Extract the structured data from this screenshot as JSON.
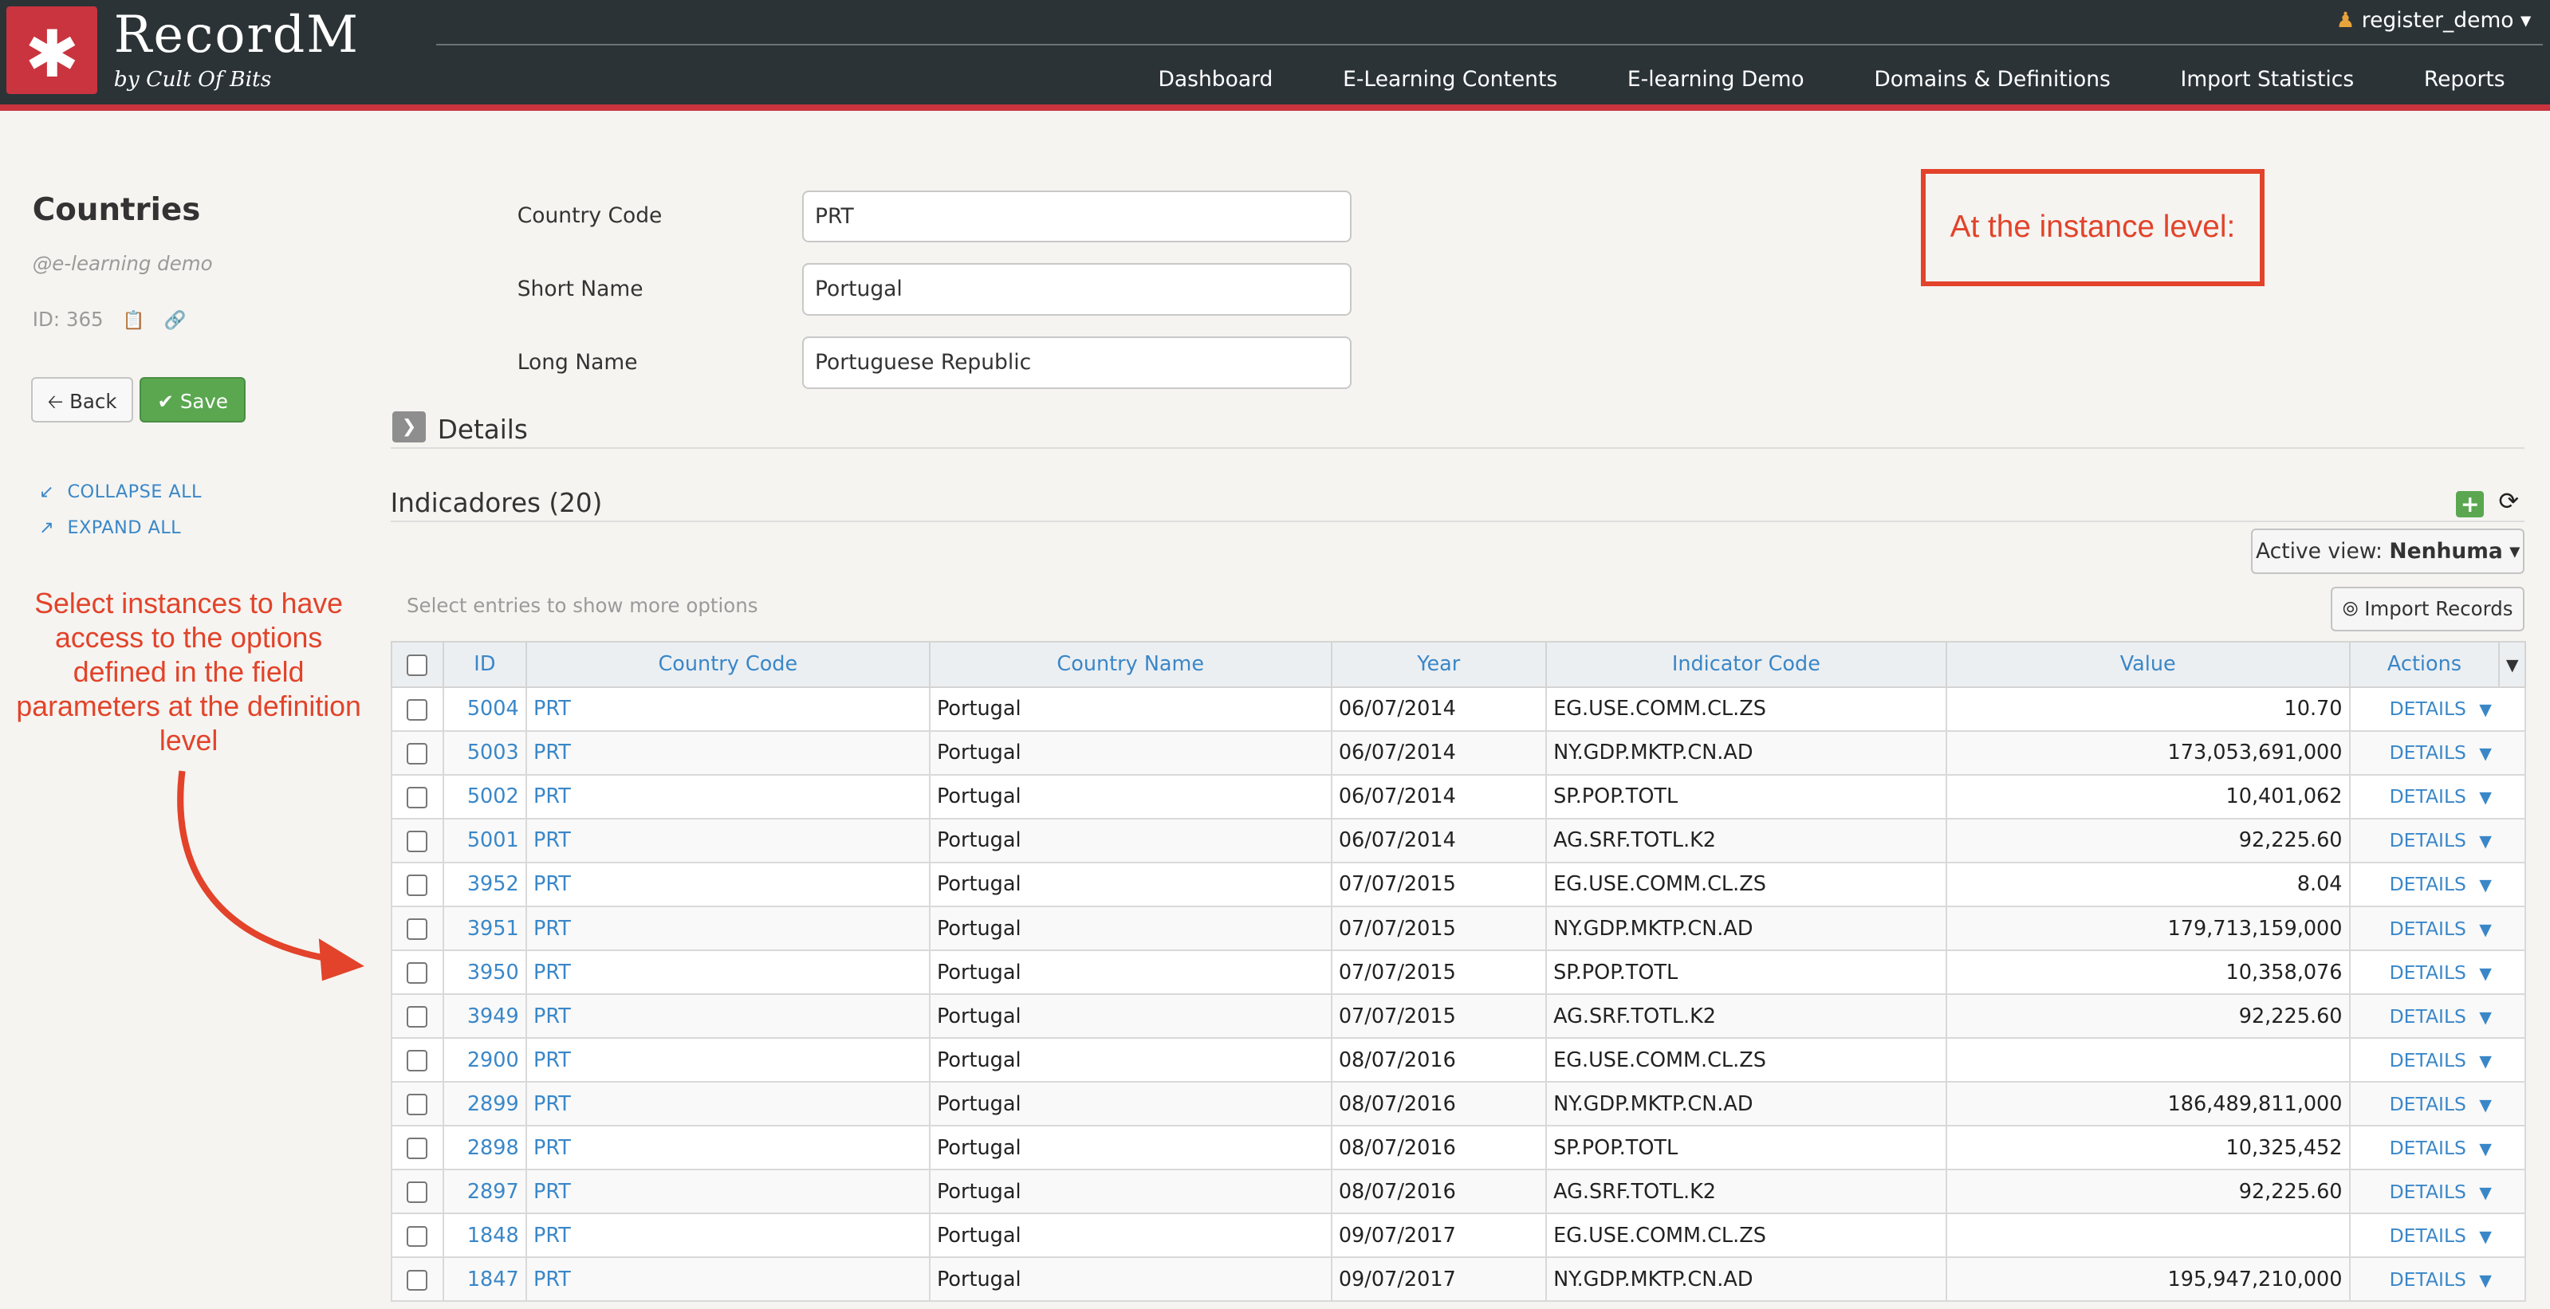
{
  "app": {
    "logo_symbol": "✱",
    "title": "RecordM",
    "subtitle": "by Cult Of Bits",
    "user": "register_demo",
    "nav": [
      "Dashboard",
      "E-Learning Contents",
      "E-learning Demo",
      "Domains & Definitions",
      "Import Statistics",
      "Reports"
    ]
  },
  "page": {
    "title": "Countries",
    "subtitle": "@e-learning demo",
    "id_label": "ID: 365",
    "back_label": "Back",
    "save_label": "Save",
    "collapse_all": "COLLAPSE ALL",
    "expand_all": "EXPAND ALL"
  },
  "form": {
    "fields": [
      {
        "label": "Country Code",
        "value": "PRT"
      },
      {
        "label": "Short Name",
        "value": "Portugal"
      },
      {
        "label": "Long Name",
        "value": "Portuguese Republic"
      }
    ],
    "details_label": "Details"
  },
  "annotations": {
    "left": "Select instances to have access to the options defined in the field parameters at the definition level",
    "callout": "At the instance level:"
  },
  "indicadores": {
    "title": "Indicadores (20)",
    "active_view_label": "Active view:",
    "active_view_value": "Nenhuma",
    "import_label": "Import Records",
    "hint": "Select entries to show more options",
    "columns": [
      "ID",
      "Country Code",
      "Country Name",
      "Year",
      "Indicator Code",
      "Value",
      "Actions"
    ],
    "action_label": "DETAILS",
    "rows": [
      {
        "id": "5004",
        "code": "PRT",
        "name": "Portugal",
        "year": "06/07/2014",
        "indicator": "EG.USE.COMM.CL.ZS",
        "value": "10.70"
      },
      {
        "id": "5003",
        "code": "PRT",
        "name": "Portugal",
        "year": "06/07/2014",
        "indicator": "NY.GDP.MKTP.CN.AD",
        "value": "173,053,691,000"
      },
      {
        "id": "5002",
        "code": "PRT",
        "name": "Portugal",
        "year": "06/07/2014",
        "indicator": "SP.POP.TOTL",
        "value": "10,401,062"
      },
      {
        "id": "5001",
        "code": "PRT",
        "name": "Portugal",
        "year": "06/07/2014",
        "indicator": "AG.SRF.TOTL.K2",
        "value": "92,225.60"
      },
      {
        "id": "3952",
        "code": "PRT",
        "name": "Portugal",
        "year": "07/07/2015",
        "indicator": "EG.USE.COMM.CL.ZS",
        "value": "8.04"
      },
      {
        "id": "3951",
        "code": "PRT",
        "name": "Portugal",
        "year": "07/07/2015",
        "indicator": "NY.GDP.MKTP.CN.AD",
        "value": "179,713,159,000"
      },
      {
        "id": "3950",
        "code": "PRT",
        "name": "Portugal",
        "year": "07/07/2015",
        "indicator": "SP.POP.TOTL",
        "value": "10,358,076"
      },
      {
        "id": "3949",
        "code": "PRT",
        "name": "Portugal",
        "year": "07/07/2015",
        "indicator": "AG.SRF.TOTL.K2",
        "value": "92,225.60"
      },
      {
        "id": "2900",
        "code": "PRT",
        "name": "Portugal",
        "year": "08/07/2016",
        "indicator": "EG.USE.COMM.CL.ZS",
        "value": ""
      },
      {
        "id": "2899",
        "code": "PRT",
        "name": "Portugal",
        "year": "08/07/2016",
        "indicator": "NY.GDP.MKTP.CN.AD",
        "value": "186,489,811,000"
      },
      {
        "id": "2898",
        "code": "PRT",
        "name": "Portugal",
        "year": "08/07/2016",
        "indicator": "SP.POP.TOTL",
        "value": "10,325,452"
      },
      {
        "id": "2897",
        "code": "PRT",
        "name": "Portugal",
        "year": "08/07/2016",
        "indicator": "AG.SRF.TOTL.K2",
        "value": "92,225.60"
      },
      {
        "id": "1848",
        "code": "PRT",
        "name": "Portugal",
        "year": "09/07/2017",
        "indicator": "EG.USE.COMM.CL.ZS",
        "value": ""
      },
      {
        "id": "1847",
        "code": "PRT",
        "name": "Portugal",
        "year": "09/07/2017",
        "indicator": "NY.GDP.MKTP.CN.AD",
        "value": "195,947,210,000"
      }
    ]
  },
  "colors": {
    "brand_red": "#c9343e",
    "header_bg": "#2b3337",
    "link_blue": "#3a87c8",
    "annotation_red": "#e2432a",
    "save_green": "#5aa750"
  }
}
